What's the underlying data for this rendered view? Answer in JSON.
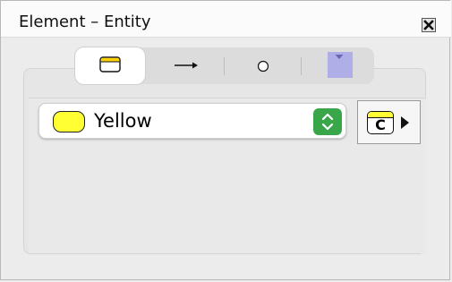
{
  "window": {
    "title": "Element – Entity"
  },
  "icons": {
    "close": "close-icon",
    "tabs": [
      "entity-shape-icon",
      "arrow-icon",
      "circle-icon",
      "color-fill-icon"
    ],
    "stepper": "up-down-chevron-icon",
    "class_entity": "class-entity-icon",
    "expand": "triangle-right-icon"
  },
  "style_select": {
    "value": "Yellow"
  },
  "class_button": {
    "letter": "C"
  },
  "colors": {
    "selected_swatch": "#ffff33",
    "stepper": "#3aa64a",
    "tab_fill": "#b0aee6"
  }
}
